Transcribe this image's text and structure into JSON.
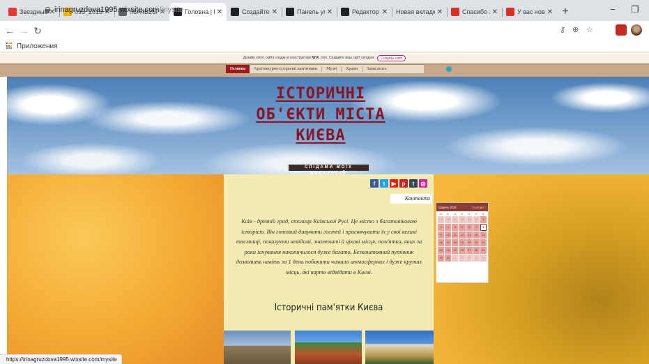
{
  "browser": {
    "tabs": [
      {
        "title": "Звездные в",
        "icon": "youtube-music-icon",
        "color": "#e53935"
      },
      {
        "title": "093_2016d_",
        "icon": "drive-icon",
        "color": "#f4b400"
      },
      {
        "title": "06A4B26F-",
        "icon": "chrome-icon",
        "color": "#5f6368"
      },
      {
        "title": "Головна | М",
        "icon": "wix-icon",
        "color": "#202124",
        "active": true
      },
      {
        "title": "Создайте с",
        "icon": "wix-icon",
        "color": "#202124"
      },
      {
        "title": "Панель упр",
        "icon": "wix-icon",
        "color": "#202124"
      },
      {
        "title": "Редактор с",
        "icon": "wix-icon",
        "color": "#202124"
      },
      {
        "title": "Новая вкладка",
        "icon": "",
        "color": ""
      },
      {
        "title": "Спасибо за",
        "icon": "gmail-icon",
        "color": "#d93025"
      },
      {
        "title": "У вас новая",
        "icon": "gmail-icon",
        "color": "#d93025"
      }
    ],
    "tab_close": "✕",
    "new_tab": "+",
    "minimize": "−",
    "maximize": "❐",
    "url_host": "irinagruzdova1995.wixsite.com",
    "url_path": "/mysite",
    "bookmarks_label": "Приложения",
    "status_url": "https://irinagruzdova1995.wixsite.com/mysite"
  },
  "wix_banner": {
    "text_before": "Дизайн этого сайта создан в конструкторе",
    "brand": "WiX",
    "text_after": ".com. Создайте ваш сайт сегодня.",
    "button": "Создать сайт"
  },
  "site": {
    "nav": [
      {
        "label": "Головна",
        "current": true
      },
      {
        "label": "Архітектурно-історичні пам'ятники"
      },
      {
        "label": "Музеї"
      },
      {
        "label": "Храми"
      },
      {
        "label": "Записатись"
      }
    ],
    "title_lines": [
      "ІСТОРИЧНІ",
      "ОБ'ЄКТИ МІСТА",
      "КИЄВА"
    ],
    "subtitle": "СЛІДАМИ МОЇХ ЕКСКУРСІЙ",
    "contacts": "Контакти",
    "intro": "Київ - древній град, столиця Київської Русі. Це місто з багатовіковою історією. Він готовий дивувати гостей і присвячувати їх у свої великі таємниці, показуючи невідомі, знамениті й цікаві місця, пам'ятки, яких за роки існування накопичилося дуже багато.  Безкоштовний путівник дозволить навіть за 1 день побачити чимало атмосферних і дуже крутих місць, які варто відвідати в Києві.",
    "section_title": "Історичні пам'ятки Києва",
    "social": [
      {
        "icon": "facebook-icon",
        "glyph": "f",
        "color": "#3b5998"
      },
      {
        "icon": "twitter-icon",
        "glyph": "t",
        "color": "#1da1f2"
      },
      {
        "icon": "youtube-icon",
        "glyph": "▶",
        "color": "#e62117"
      },
      {
        "icon": "pinterest-icon",
        "glyph": "p",
        "color": "#cb2027"
      },
      {
        "icon": "tumblr-icon",
        "glyph": "t",
        "color": "#35465c"
      },
      {
        "icon": "instagram-icon",
        "glyph": "◎",
        "color": "#d6249f"
      }
    ]
  },
  "calendar": {
    "month": "грудень 2019",
    "prev": "‹",
    "today_btn": "Сьогодні",
    "next": "›",
    "weekdays": [
      "пн",
      "вт",
      "ср",
      "чт",
      "пт",
      "сб",
      "нд"
    ],
    "days": [
      {
        "d": "25",
        "muted": true
      },
      {
        "d": "26",
        "muted": true
      },
      {
        "d": "27",
        "muted": true
      },
      {
        "d": "28",
        "muted": true
      },
      {
        "d": "29",
        "muted": true
      },
      {
        "d": "30",
        "muted": true
      },
      {
        "d": "1"
      },
      {
        "d": "2"
      },
      {
        "d": "3"
      },
      {
        "d": "4"
      },
      {
        "d": "5"
      },
      {
        "d": "6"
      },
      {
        "d": "7"
      },
      {
        "d": "8",
        "today": true
      },
      {
        "d": "9"
      },
      {
        "d": "10"
      },
      {
        "d": "11"
      },
      {
        "d": "12"
      },
      {
        "d": "13"
      },
      {
        "d": "14"
      },
      {
        "d": "15"
      },
      {
        "d": "16"
      },
      {
        "d": "17"
      },
      {
        "d": "18"
      },
      {
        "d": "19"
      },
      {
        "d": "20"
      },
      {
        "d": "21"
      },
      {
        "d": "22"
      },
      {
        "d": "23"
      },
      {
        "d": "24"
      },
      {
        "d": "25"
      },
      {
        "d": "26"
      },
      {
        "d": "27"
      },
      {
        "d": "28"
      },
      {
        "d": "29"
      },
      {
        "d": "30"
      },
      {
        "d": "31"
      },
      {
        "d": "1",
        "muted": true
      },
      {
        "d": "2",
        "muted": true
      },
      {
        "d": "3",
        "muted": true
      },
      {
        "d": "4",
        "muted": true
      },
      {
        "d": "5",
        "muted": true
      }
    ]
  }
}
